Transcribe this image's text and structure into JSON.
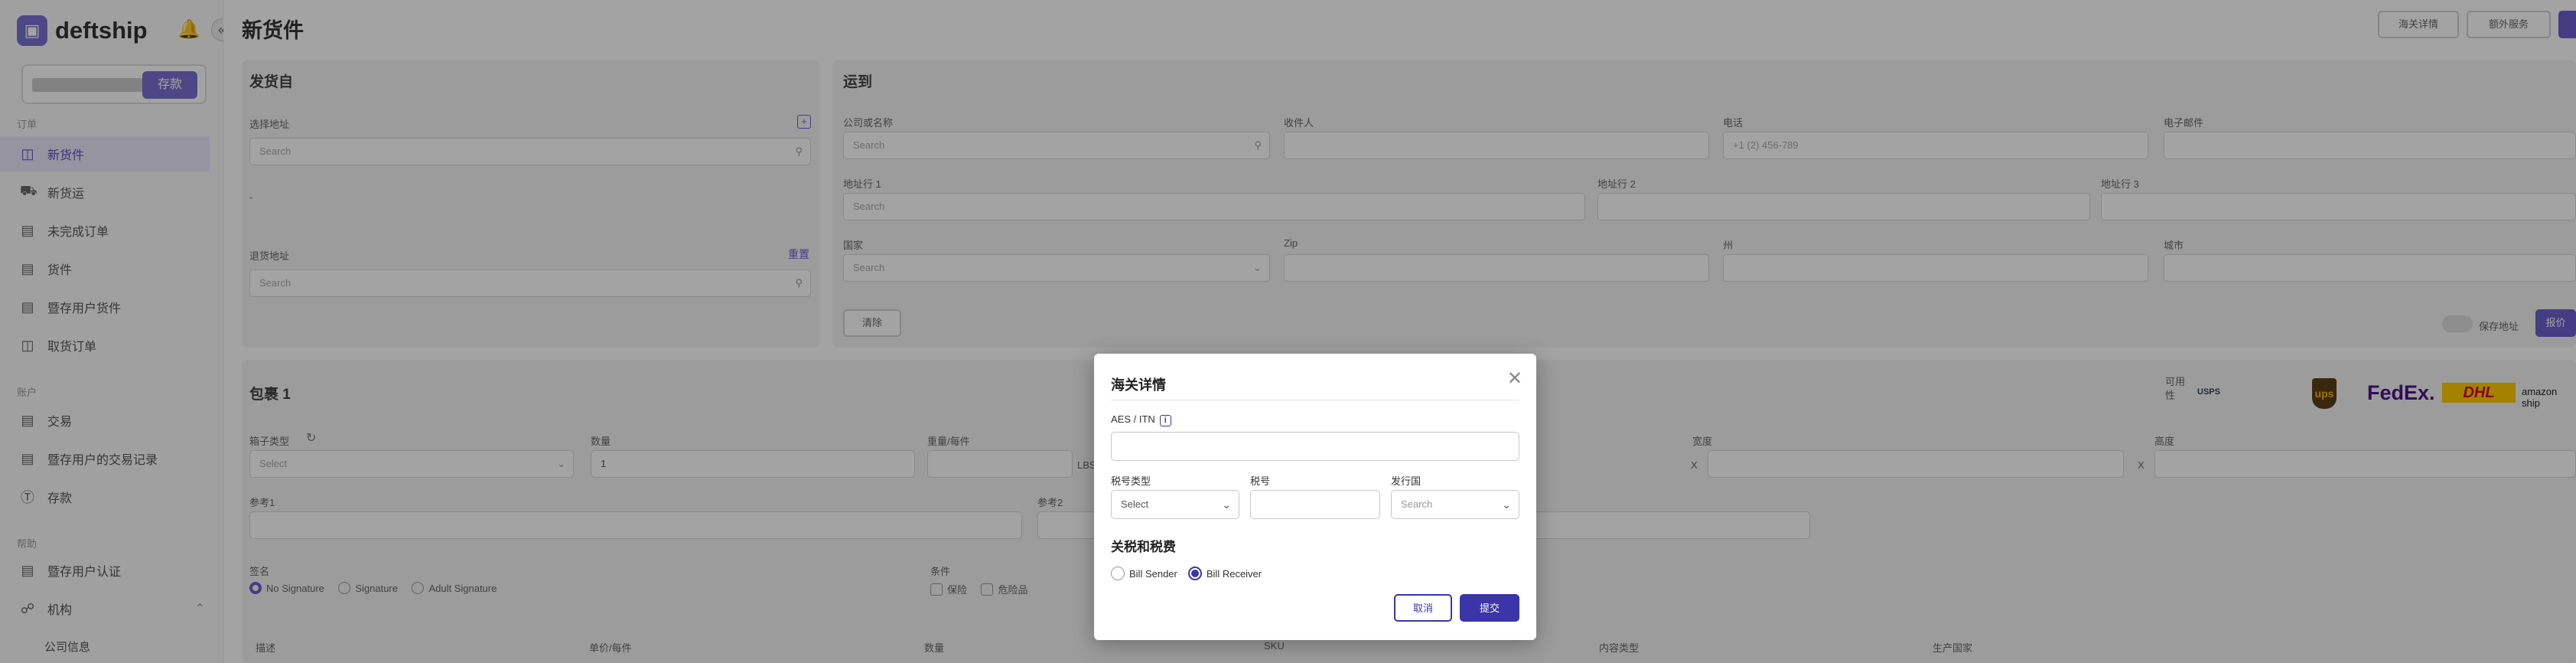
{
  "app": {
    "name": "deftship"
  },
  "sidebar": {
    "account_btn": "存款",
    "sections": [
      "订单",
      "账户",
      "帮助"
    ],
    "items": [
      {
        "label": "新货件",
        "icon": "box-icon"
      },
      {
        "label": "新货运",
        "icon": "truck-icon"
      },
      {
        "label": "未完成订单",
        "icon": "clipboard-icon"
      },
      {
        "label": "货件",
        "icon": "file-icon"
      },
      {
        "label": "暨存用户货件",
        "icon": "file-icon"
      },
      {
        "label": "取货订单",
        "icon": "gift-icon"
      },
      {
        "label": "交易",
        "icon": "wallet-icon"
      },
      {
        "label": "暨存用户的交易记录",
        "icon": "wallet-icon"
      },
      {
        "label": "存款",
        "icon": "dollar-icon"
      },
      {
        "label": "暨存用户认证",
        "icon": "clipboard-icon"
      },
      {
        "label": "机构",
        "icon": "org-icon"
      }
    ],
    "sub_item": "公司信息"
  },
  "header": {
    "title": "新货件",
    "buttons": [
      "海关详情",
      "额外服务"
    ]
  },
  "ship_from": {
    "title": "发货自",
    "select_address": "选择地址",
    "search_placeholder": "Search",
    "dash": "-",
    "return_address": "退货地址",
    "reset": "重置"
  },
  "ship_to": {
    "title": "运到",
    "company_name": "公司或名称",
    "recipient": "收件人",
    "phone": "电话",
    "phone_placeholder": "+1 (2) 456-789",
    "email": "电子邮件",
    "address1": "地址行 1",
    "address2": "地址行 2",
    "address3": "地址行 3",
    "country": "国家",
    "zip": "Zip",
    "state": "州",
    "city": "城市",
    "search_placeholder": "Search",
    "clear": "清除",
    "save_address": "保存地址",
    "get_rates": "报价"
  },
  "package": {
    "title": "包裹 1",
    "box_type": "箱子类型",
    "select_placeholder": "Select",
    "quantity": "数量",
    "quantity_value": "1",
    "weight": "重量/每件",
    "weight_unit": "LBS",
    "width": "宽度",
    "height": "高度",
    "x1": "X",
    "x2": "X",
    "reference1": "参考1",
    "reference2": "参考2",
    "signature": "签名",
    "sig_options": [
      "No Signature",
      "Signature",
      "Adult Signature"
    ],
    "extras": "条件",
    "extra_options": [
      "保险",
      "危险品"
    ],
    "available": "可用",
    "available2": "性",
    "carriers": [
      "USPS",
      "ups",
      "FedEx.",
      "DHL",
      "amazon ship"
    ],
    "columns": [
      "描述",
      "单价/每件",
      "数量",
      "SKU",
      "内容类型",
      "生产国家"
    ]
  },
  "customs_modal": {
    "title": "海关详情",
    "aes_label": "AES / ITN",
    "info_icon": "i",
    "tax_type_label": "税号类型",
    "tax_type_value": "Select",
    "tax_id_label": "税号",
    "issuing_country_label": "发行国",
    "issuing_country_placeholder": "Search",
    "duties_section": "关税和税费",
    "options": [
      "Bill Sender",
      "Bill Receiver"
    ],
    "selected_option": "Bill Receiver",
    "cancel": "取消",
    "submit": "提交"
  }
}
